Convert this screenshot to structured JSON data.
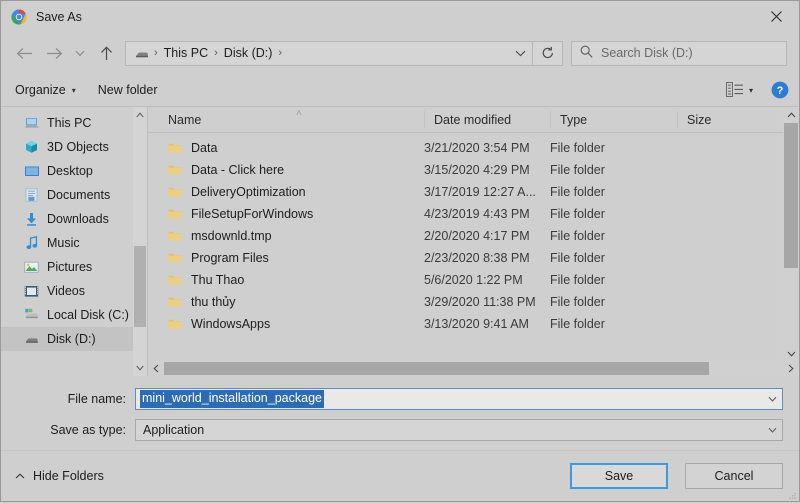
{
  "window": {
    "title": "Save As",
    "app_icon": "chrome-icon",
    "close_label": "✕"
  },
  "nav": {
    "back_icon": "arrow-left-icon",
    "forward_icon": "arrow-right-icon",
    "recent_icon": "chevron-down-icon",
    "up_icon": "arrow-up-icon",
    "refresh_icon": "refresh-icon",
    "breadcrumbs": [
      "This PC",
      "Disk (D:)"
    ],
    "breadcrumb_separator": "›",
    "address_caret": "chevron-down-icon"
  },
  "search": {
    "placeholder": "Search Disk (D:)",
    "icon": "search-icon"
  },
  "commandbar": {
    "organize_label": "Organize",
    "organize_caret": "▾",
    "new_folder_label": "New folder",
    "view_icon": "list-view-icon",
    "view_caret": "▾",
    "help_icon": "help-icon",
    "help_glyph": "?"
  },
  "sidebar": {
    "items": [
      {
        "label": "This PC",
        "icon": "computer-icon",
        "selected": false
      },
      {
        "label": "3D Objects",
        "icon": "3d-objects-icon",
        "selected": false
      },
      {
        "label": "Desktop",
        "icon": "desktop-icon",
        "selected": false
      },
      {
        "label": "Documents",
        "icon": "documents-icon",
        "selected": false
      },
      {
        "label": "Downloads",
        "icon": "downloads-icon",
        "selected": false
      },
      {
        "label": "Music",
        "icon": "music-icon",
        "selected": false
      },
      {
        "label": "Pictures",
        "icon": "pictures-icon",
        "selected": false
      },
      {
        "label": "Videos",
        "icon": "videos-icon",
        "selected": false
      },
      {
        "label": "Local Disk (C:)",
        "icon": "hard-drive-icon",
        "selected": false
      },
      {
        "label": "Disk (D:)",
        "icon": "drive-icon",
        "selected": true
      }
    ]
  },
  "filelist": {
    "columns": [
      "Name",
      "Date modified",
      "Type",
      "Size"
    ],
    "sort_column": "Name",
    "sort_arrow": "˄",
    "rows": [
      {
        "name": "Data",
        "date": "3/21/2020 3:54 PM",
        "type": "File folder",
        "size": ""
      },
      {
        "name": "Data - Click here",
        "date": "3/15/2020 4:29 PM",
        "type": "File folder",
        "size": ""
      },
      {
        "name": "DeliveryOptimization",
        "date": "3/17/2019 12:27 A...",
        "type": "File folder",
        "size": ""
      },
      {
        "name": "FileSetupForWindows",
        "date": "4/23/2019 4:43 PM",
        "type": "File folder",
        "size": ""
      },
      {
        "name": "msdownld.tmp",
        "date": "2/20/2020 4:17 PM",
        "type": "File folder",
        "size": ""
      },
      {
        "name": "Program Files",
        "date": "2/23/2020 8:38 PM",
        "type": "File folder",
        "size": ""
      },
      {
        "name": "Thu Thao",
        "date": "5/6/2020 1:22 PM",
        "type": "File folder",
        "size": ""
      },
      {
        "name": "thu thủy",
        "date": "3/29/2020 11:38 PM",
        "type": "File folder",
        "size": ""
      },
      {
        "name": "WindowsApps",
        "date": "3/13/2020 9:41 AM",
        "type": "File folder",
        "size": ""
      }
    ]
  },
  "form": {
    "filename_label": "File name:",
    "filename_value": "mini_world_installation_package",
    "savetype_label": "Save as type:",
    "savetype_value": "Application",
    "dropdown_caret": "˅"
  },
  "footer": {
    "hide_folders_label": "Hide Folders",
    "hide_folders_caret": "˄",
    "save_label": "Save",
    "cancel_label": "Cancel"
  },
  "colors": {
    "window_bg": "#cfcfcf",
    "selection_blue": "#2d6cb5",
    "focus_blue": "#3b9ad9",
    "highlight_red": "#ef2020",
    "folder_yellow": "#e8c36a"
  }
}
